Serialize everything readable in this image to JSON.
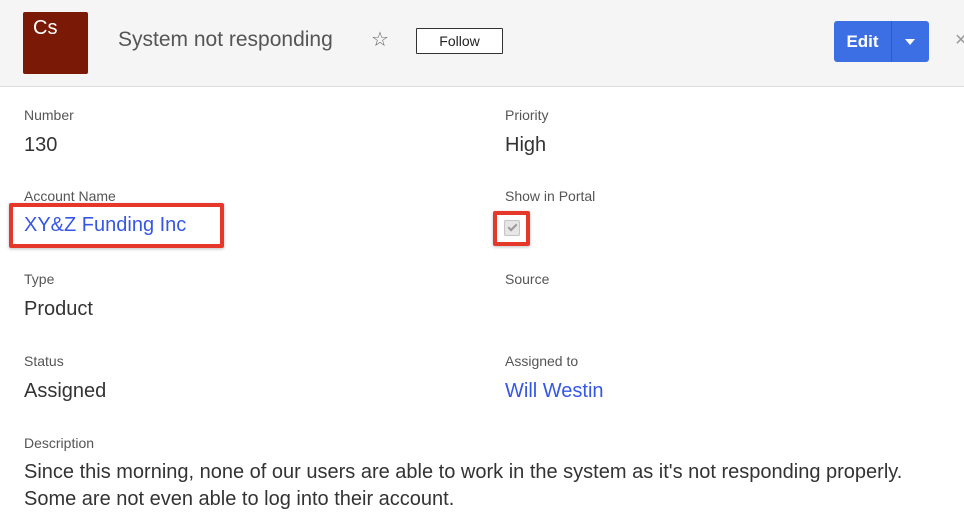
{
  "header": {
    "avatar_text": "Cs",
    "avatar_color": "#7a1a06",
    "title": "System not responding",
    "favorite_icon": "star-outline-icon",
    "follow_label": "Follow",
    "edit_label": "Edit",
    "edit_menu_icon": "chevron-down-icon",
    "close_icon": "close-icon",
    "accent_color": "#3b6fe3"
  },
  "fields": {
    "number": {
      "label": "Number",
      "value": "130"
    },
    "priority": {
      "label": "Priority",
      "value": "High"
    },
    "account_name": {
      "label": "Account Name",
      "value": "XY&Z Funding Inc"
    },
    "show_in_portal": {
      "label": "Show in Portal",
      "checked": true
    },
    "type": {
      "label": "Type",
      "value": "Product"
    },
    "source": {
      "label": "Source",
      "value": ""
    },
    "status": {
      "label": "Status",
      "value": "Assigned"
    },
    "assigned_to": {
      "label": "Assigned to",
      "value": "Will Westin"
    },
    "description": {
      "label": "Description",
      "value": "Since this morning, none of our users are able to work in the system as it's not responding properly. Some are not even able to log into their account."
    }
  },
  "highlight_color": "#e6382a",
  "link_color": "#3557e6"
}
